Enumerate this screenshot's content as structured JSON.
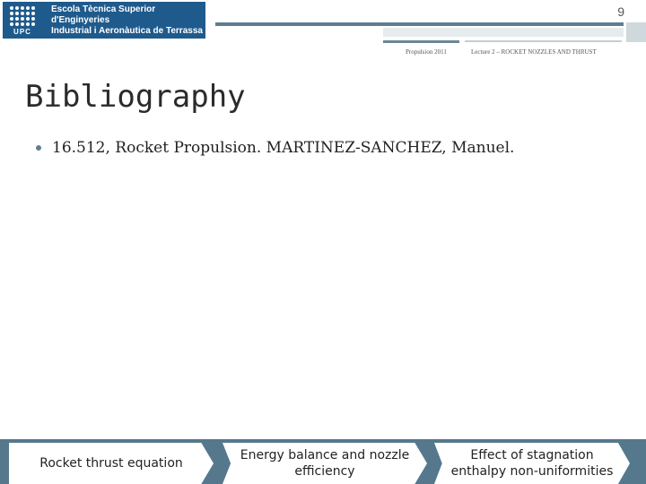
{
  "logo": {
    "mark_text": "UPC",
    "line1": "Escola Tècnica Superior d'Enginyeries",
    "line2": "Industrial i Aeronàutica de Terrassa"
  },
  "page_number": "9",
  "header": {
    "left": "Propulsion 2011",
    "right": "Lecture 2 – ROCKET NOZZLES AND THRUST"
  },
  "title": "Bibliography",
  "bullets": [
    "16.512, Rocket Propulsion. MARTINEZ-SANCHEZ, Manuel."
  ],
  "nav": [
    {
      "label": "Rocket thrust equation"
    },
    {
      "label": "Energy balance and nozzle efficiency"
    },
    {
      "label": "Effect of stagnation enthalpy non-uniformities"
    }
  ],
  "colors": {
    "brand_blue": "#1f5a8c",
    "accent_slate": "#56788d"
  }
}
